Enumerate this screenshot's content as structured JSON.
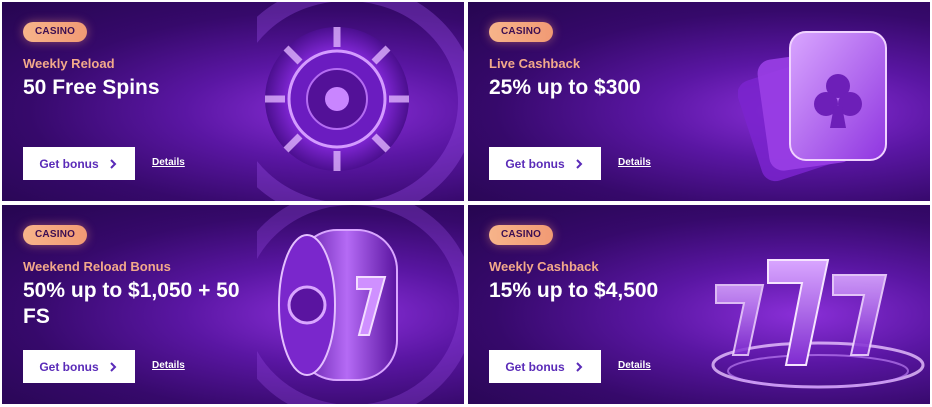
{
  "cards": [
    {
      "badge": "CASINO",
      "subtitle": "Weekly Reload",
      "title": "50 Free Spins",
      "button_label": "Get bonus",
      "details_label": "Details",
      "art_icon": "roulette-wheel-icon"
    },
    {
      "badge": "CASINO",
      "subtitle": "Live Cashback",
      "title": "25% up to $300",
      "button_label": "Get bonus",
      "details_label": "Details",
      "art_icon": "playing-cards-clubs-icon"
    },
    {
      "badge": "CASINO",
      "subtitle": "Weekend Reload Bonus",
      "title": "50% up to $1,050 + 50 FS",
      "button_label": "Get bonus",
      "details_label": "Details",
      "art_icon": "slot-reel-seven-icon"
    },
    {
      "badge": "CASINO",
      "subtitle": "Weekly Cashback",
      "title": "15% up to $4,500",
      "button_label": "Get bonus",
      "details_label": "Details",
      "art_icon": "triple-seven-icon"
    }
  ],
  "colors": {
    "background_dark": "#260650",
    "background_mid": "#5a16a3",
    "badge": "#f7b48a",
    "subtitle": "#f3a98a",
    "button_text": "#5a2bb8"
  }
}
